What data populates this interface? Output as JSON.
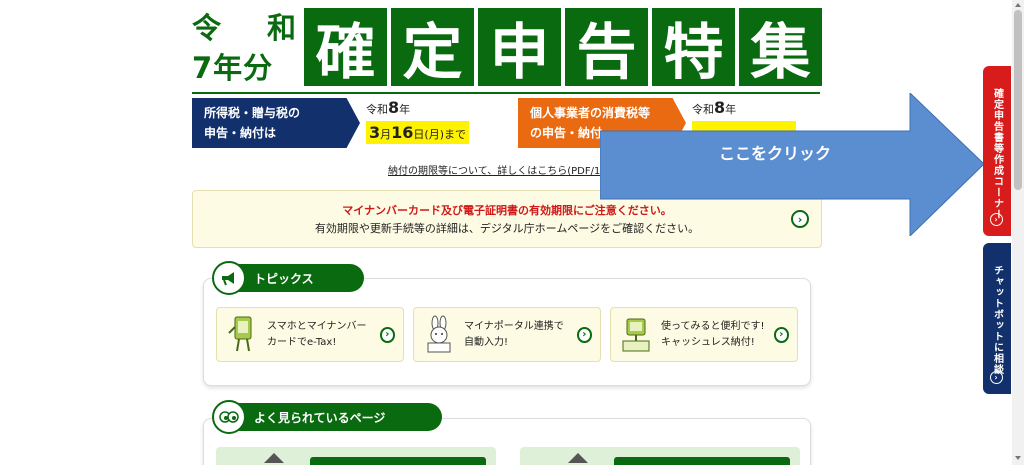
{
  "header": {
    "era_line1_a": "令",
    "era_line1_b": "和",
    "era_line2": "7年分",
    "title_chars": [
      "確",
      "定",
      "申",
      "告",
      "特",
      "集"
    ]
  },
  "deadlines": {
    "income": {
      "label_line1": "所得税・贈与税の",
      "label_line2": "申告・納付は",
      "year_prefix": "令和",
      "year_num": "8",
      "year_suffix": "年",
      "month": "3",
      "month_unit": "月",
      "day": "16",
      "day_unit": "日",
      "weekday": "(月)",
      "until": "まで"
    },
    "business": {
      "label_line1": "個人事業者の消費税等",
      "label_line2": "の申告・納付",
      "year_prefix": "令和",
      "year_num": "8",
      "year_suffix": "年"
    },
    "detail_link": "納付の期限等について、詳しくはこちら(PDF/1.7M"
  },
  "notice": {
    "line1": "マイナンバーカード及び電子証明書の有効期限にご注意ください。",
    "line2": "有効期限や更新手続等の詳細は、デジタル庁ホームページをご確認ください。"
  },
  "topics": {
    "heading": "トピックス",
    "cards": [
      {
        "line1": "スマホとマイナンバー",
        "line2": "カードでe-Tax!"
      },
      {
        "line1": "マイナポータル連携で",
        "line2": "自動入力!"
      },
      {
        "line1": "使ってみると便利です!",
        "line2": "キャッシュレス納付!"
      }
    ]
  },
  "popular": {
    "heading": "よく見られているページ"
  },
  "annotation": {
    "text": "ここをクリック",
    "fill": "#5b8ed1"
  },
  "side_tabs": {
    "create": "確定申告書等作成コーナー",
    "chatbot": "チャットボットに相談"
  },
  "colors": {
    "brand_green": "#0a6a10",
    "navy": "#12306b",
    "orange": "#ea6a12",
    "red": "#d81c1c",
    "highlight": "#fff200"
  }
}
